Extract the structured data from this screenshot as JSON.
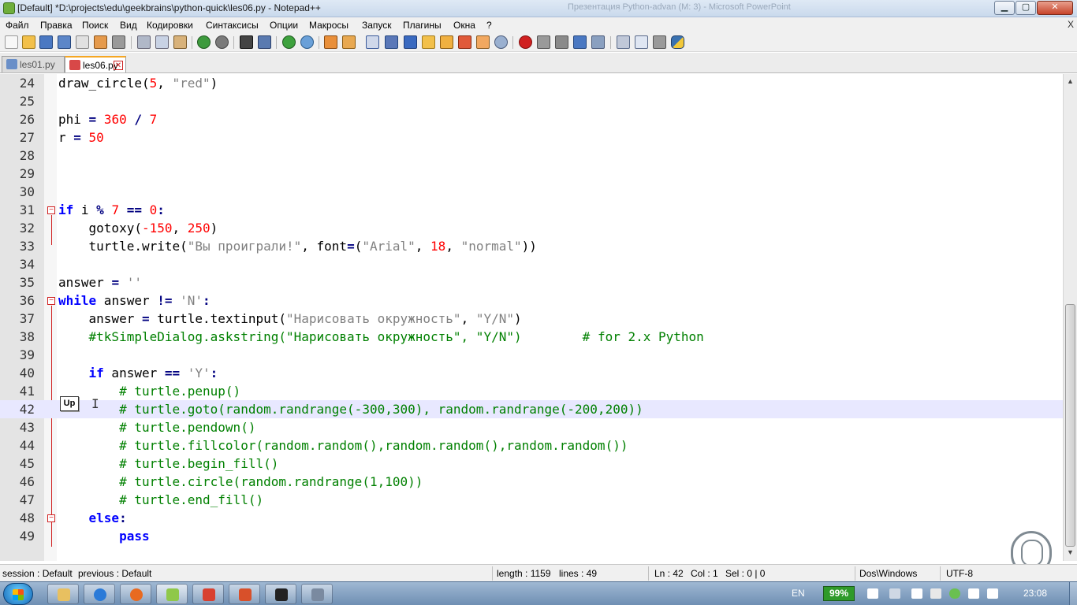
{
  "window": {
    "title": "[Default] *D:\\projects\\edu\\geekbrains\\python-quick\\les06.py - Notepad++",
    "background_title": "Презентация Python-advan (М: 3) - Microsoft PowerPoint",
    "minimize": "▁",
    "maximize": "▢",
    "close": "✕"
  },
  "menu": {
    "items": [
      "Файл",
      "Правка",
      "Поиск",
      "Вид",
      "Кодировки",
      "Синтаксисы",
      "Опции",
      "Макросы",
      "Запуск",
      "Плагины",
      "Окна",
      "?"
    ],
    "close_doc": "X"
  },
  "tabs": [
    {
      "label": "les01.py",
      "active": false
    },
    {
      "label": "les06.py",
      "active": true
    }
  ],
  "editor": {
    "current_line": 42,
    "tooltip": "Up",
    "lines": [
      {
        "no": "24"
      },
      {
        "no": "25"
      },
      {
        "no": "26"
      },
      {
        "no": "27"
      },
      {
        "no": "28"
      },
      {
        "no": "29"
      },
      {
        "no": "30"
      },
      {
        "no": "31"
      },
      {
        "no": "32"
      },
      {
        "no": "33"
      },
      {
        "no": "34"
      },
      {
        "no": "35"
      },
      {
        "no": "36"
      },
      {
        "no": "37"
      },
      {
        "no": "38"
      },
      {
        "no": "39"
      },
      {
        "no": "40"
      },
      {
        "no": "41"
      },
      {
        "no": "42"
      },
      {
        "no": "43"
      },
      {
        "no": "44"
      },
      {
        "no": "45"
      },
      {
        "no": "46"
      },
      {
        "no": "47"
      },
      {
        "no": "48"
      },
      {
        "no": "49"
      }
    ],
    "code": {
      "l24": {
        "a": "draw_circle(",
        "b": "5",
        "c": ", ",
        "d": "\"red\"",
        "e": ")"
      },
      "l26": {
        "a": "phi ",
        "b": "=",
        "c": " ",
        "d": "360",
        "e": " ",
        "f": "/",
        "g": " ",
        "h": "7"
      },
      "l27": {
        "a": "r ",
        "b": "=",
        "c": " ",
        "d": "50"
      },
      "l31": {
        "kw": "if",
        "a": " i ",
        "b": "%",
        "c": " ",
        "d": "7",
        "e": " ",
        "f": "==",
        "g": " ",
        "h": "0",
        "i": ":"
      },
      "l32": {
        "a": "    gotoxy(",
        "b": "-150",
        "c": ", ",
        "d": "250",
        "e": ")"
      },
      "l33": {
        "a": "    turtle.write(",
        "b": "\"Вы проиграли!\"",
        "c": ", font",
        "d": "=",
        "e": "(",
        "f": "\"Arial\"",
        "g": ", ",
        "h": "18",
        "i": ", ",
        "j": "\"normal\"",
        "k": "))"
      },
      "l35": {
        "a": "answer ",
        "b": "=",
        "c": " ",
        "d": "''"
      },
      "l36": {
        "kw": "while",
        "a": " answer ",
        "b": "!=",
        "c": " ",
        "d": "'N'",
        "e": ":"
      },
      "l37": {
        "a": "    answer ",
        "b": "=",
        "c": " turtle.textinput(",
        "d": "\"Нарисовать окружность\"",
        "e": ", ",
        "f": "\"Y/N\"",
        "g": ")"
      },
      "l38": {
        "a": "    ",
        "b": "#tkSimpleDialog.askstring(\"Нарисовать окружность\", \"Y/N\")",
        "c": "        ",
        "d": "# for 2.x Python"
      },
      "l40": {
        "a": "    ",
        "kw": "if",
        "b": " answer ",
        "c": "==",
        "d": " ",
        "e": "'Y'",
        "f": ":"
      },
      "l41": {
        "a": "        ",
        "b": "# turtle.penup()"
      },
      "l42": {
        "a": "        ",
        "b": "# turtle.goto(random.randrange(-300,300), random.randrange(-200,200))"
      },
      "l43": {
        "a": "        ",
        "b": "# turtle.pendown()"
      },
      "l44": {
        "a": "        ",
        "b": "# turtle.fillcolor(random.random(),random.random(),random.random())"
      },
      "l45": {
        "a": "        ",
        "b": "# turtle.begin_fill()"
      },
      "l46": {
        "a": "        ",
        "b": "# turtle.circle(random.randrange(1,100))"
      },
      "l47": {
        "a": "        ",
        "b": "# turtle.end_fill()"
      },
      "l48": {
        "a": "    ",
        "kw": "else",
        "b": ":"
      },
      "l49": {
        "a": "        ",
        "kw": "pass"
      }
    }
  },
  "statusbar": {
    "session": "session : Default",
    "previous": "previous : Default",
    "length": "length : 1159",
    "lines": "lines : 49",
    "ln": "Ln : 42",
    "col": "Col : 1",
    "sel": "Sel : 0 | 0",
    "eol": "Dos\\Windows",
    "encoding": "UTF-8"
  },
  "taskbar": {
    "lang": "EN",
    "battery": "99%",
    "clock": "23:08"
  },
  "colors": {
    "keyword": "#0000ff",
    "number": "#ff0000",
    "string": "#808080",
    "comment": "#008000",
    "current_line": "#e8e8ff",
    "fold_marker": "#d02020"
  }
}
